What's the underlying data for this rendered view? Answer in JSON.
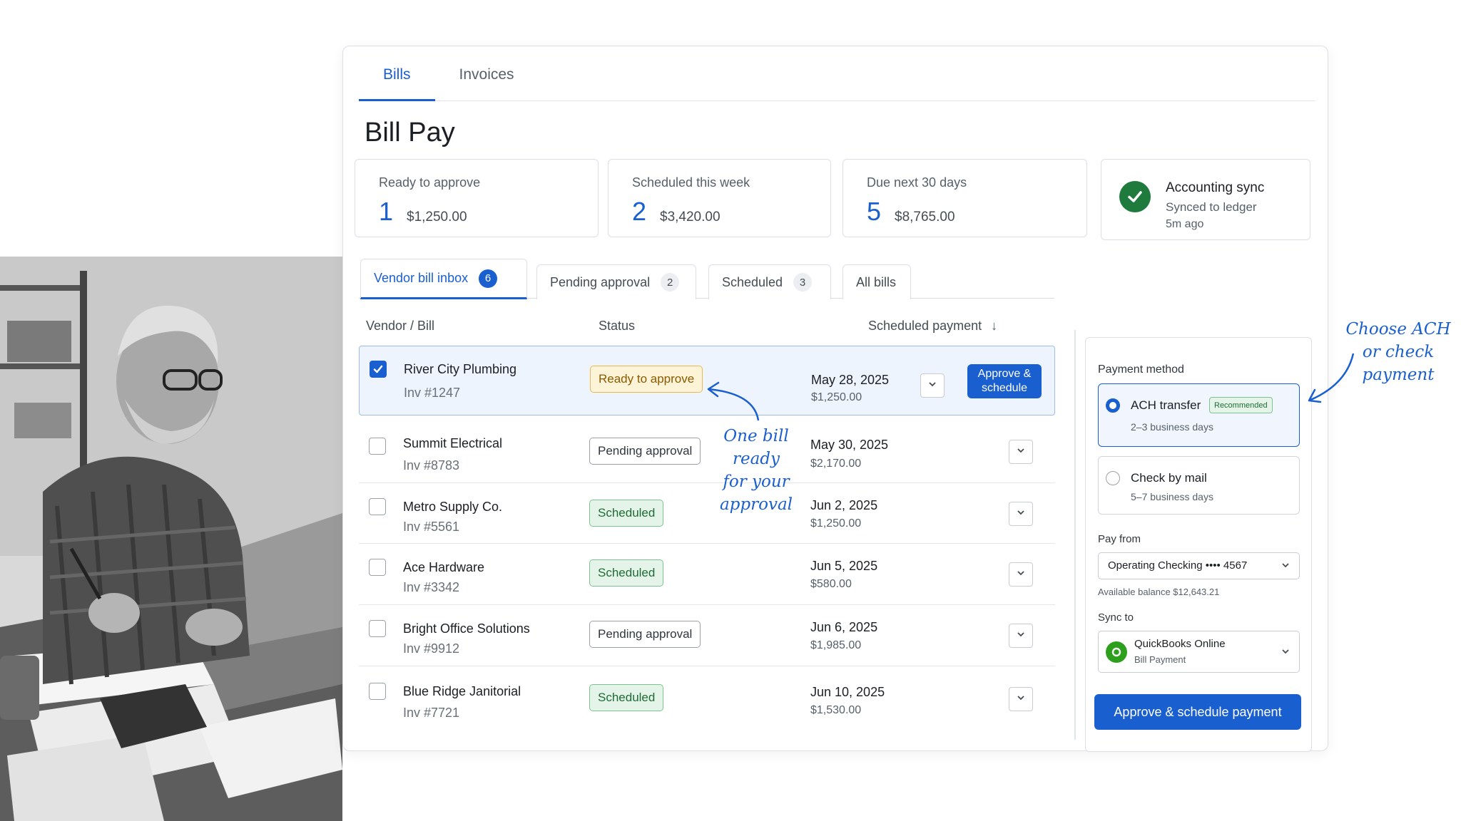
{
  "top_tabs": [
    {
      "label": "Bills"
    },
    {
      "label": "Invoices"
    }
  ],
  "page_title": "Bill Pay",
  "stats": {
    "ready": {
      "label": "Ready to approve",
      "count": "1",
      "amount": "$1,250.00"
    },
    "scheduled": {
      "label": "Scheduled this week",
      "count": "2",
      "amount": "$3,420.00"
    },
    "due": {
      "label": "Due next 30 days",
      "count": "5",
      "amount": "$8,765.00"
    },
    "sync": {
      "title": "Accounting sync",
      "subtitle": "Synced to ledger",
      "time": "5m ago"
    }
  },
  "filter_tabs": [
    {
      "label": "Vendor bill inbox",
      "count": "6"
    },
    {
      "label": "Pending approval",
      "count": "2"
    },
    {
      "label": "Scheduled",
      "count": "3"
    },
    {
      "label": "All bills"
    }
  ],
  "columns": {
    "vendor": "Vendor / Bill",
    "status": "Status",
    "payment": "Scheduled payment",
    "sort_icon": "arrow-down-icon"
  },
  "bills": [
    {
      "vendor": "River City Plumbing",
      "invoice": "Inv #1247",
      "status": "Ready to approve",
      "status_type": "ready",
      "date": "May 28, 2025",
      "amount": "$1,250.00",
      "checked": true,
      "action": "Approve &\nschedule"
    },
    {
      "vendor": "Summit Electrical",
      "invoice": "Inv #8783",
      "status": "Pending approval",
      "status_type": "pending",
      "date": "May 30, 2025",
      "amount": "$2,170.00",
      "checked": false
    },
    {
      "vendor": "Metro Supply Co.",
      "invoice": "Inv #5561",
      "status": "Scheduled",
      "status_type": "scheduled",
      "date": "Jun 2, 2025",
      "amount": "$1,250.00",
      "checked": false
    },
    {
      "vendor": "Ace Hardware",
      "invoice": "Inv #3342",
      "status": "Scheduled",
      "status_type": "scheduled",
      "date": "Jun 5, 2025",
      "amount": "$580.00",
      "checked": false
    },
    {
      "vendor": "Bright Office Solutions",
      "invoice": "Inv #9912",
      "status": "Pending approval",
      "status_type": "pending",
      "date": "Jun 6, 2025",
      "amount": "$1,985.00",
      "checked": false
    },
    {
      "vendor": "Blue Ridge Janitorial",
      "invoice": "Inv #7721",
      "status": "Scheduled",
      "status_type": "scheduled",
      "date": "Jun 10, 2025",
      "amount": "$1,530.00",
      "checked": false
    }
  ],
  "approve_label": "Approve & schedule",
  "panel": {
    "payment_method_label": "Payment method",
    "ach": {
      "title": "ACH transfer",
      "badge": "Recommended",
      "sub": "2–3 business days",
      "selected": true
    },
    "check": {
      "title": "Check by mail",
      "sub": "5–7 business days",
      "selected": false
    },
    "pay_from_label": "Pay from",
    "pay_from_value": "Operating Checking •••• 4567",
    "balance": "Available balance $12,643.21",
    "sync_to_label": "Sync to",
    "sync_to_title": "QuickBooks Online",
    "sync_to_sub": "Bill Payment",
    "primary_button": "Approve & schedule payment"
  },
  "annotations": {
    "bill": [
      "One bill",
      "ready",
      "for your",
      "approval"
    ],
    "method": [
      "Choose ACH",
      "or check",
      "payment"
    ]
  },
  "colors": {
    "accent": "#1a5fd0",
    "success": "#1f7a3d",
    "warning": "#e8b94c"
  }
}
